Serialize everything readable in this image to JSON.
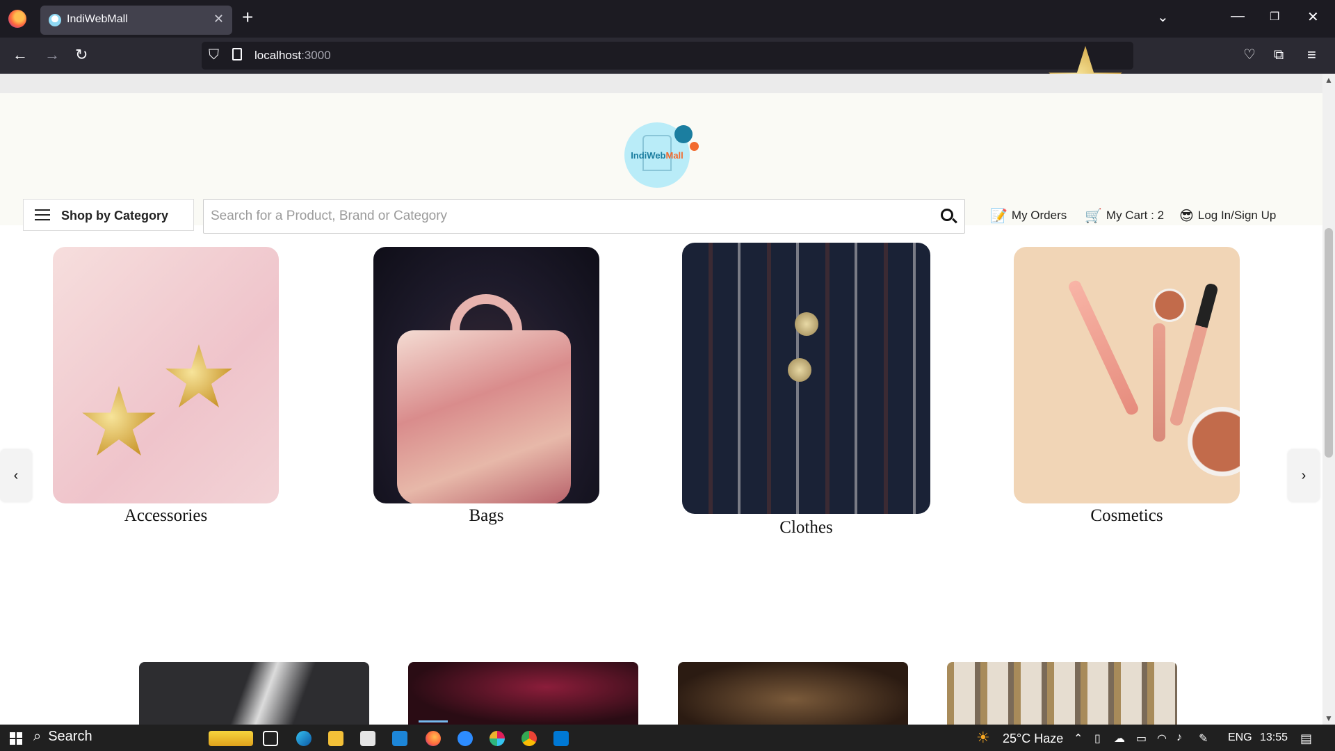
{
  "browser": {
    "tab_title": "IndiWebMall",
    "url_host": "localhost",
    "url_port": ":3000"
  },
  "site": {
    "logo_text_a": "IndiWeb",
    "logo_text_b": "Mall",
    "shop_by_category": "Shop by Category",
    "search_placeholder": "Search for a Product, Brand or Category",
    "nav": {
      "orders": "My Orders",
      "cart": "My Cart : 2",
      "login": "Log In/Sign Up"
    }
  },
  "categories": [
    {
      "label": "Accessories"
    },
    {
      "label": "Bags"
    },
    {
      "label": "Clothes"
    },
    {
      "label": "Cosmetics"
    }
  ],
  "carousel": {
    "prev": "‹",
    "next": "›"
  },
  "taskbar": {
    "search": "Search",
    "weather": "25°C  Haze",
    "lang": "ENG",
    "time": "13:55"
  },
  "colors": {
    "accent_teal": "#1b7ea0",
    "accent_orange": "#f26a2d",
    "header_bg": "#fafaf5"
  }
}
